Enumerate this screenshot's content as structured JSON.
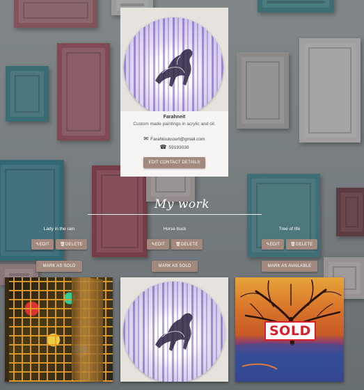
{
  "profile": {
    "name": "Farahneit",
    "tagline": "Custom made paintings in acrylic and oil.",
    "email": "Farahtoutcourt@gmail.com",
    "phone": "59193030",
    "edit_button": "EDIT CONTACT DETAILS",
    "icons": {
      "email": "envelope-icon",
      "phone": "phone-icon"
    }
  },
  "section": {
    "title": "My work"
  },
  "artworks": [
    {
      "title": "Lady in the rain",
      "edit": "EDIT",
      "delete": "DELETE",
      "status_button": "MARK AS SOLD",
      "sold": false
    },
    {
      "title": "Horse buck",
      "edit": "EDIT",
      "delete": "DELETE",
      "status_button": "MARK AS SOLD",
      "sold": false
    },
    {
      "title": "Tree of life",
      "edit": "EDIT",
      "delete": "DELETE",
      "status_button": "MARK AS AVAILABLE",
      "sold": true,
      "badge": "SOLD"
    }
  ],
  "colors": {
    "button": "#a3897d",
    "card": "#f7f5f3",
    "sold_red": "#d8202a"
  }
}
